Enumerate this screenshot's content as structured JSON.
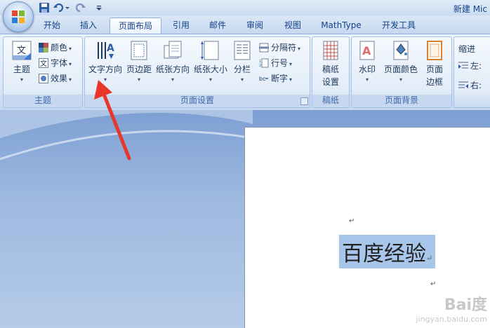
{
  "title_bar": {
    "title": "新建 Mic",
    "quick_access": [
      "save-icon",
      "undo-icon",
      "redo-icon",
      "customize-icon"
    ]
  },
  "tabs": [
    {
      "label": "开始",
      "active": false
    },
    {
      "label": "插入",
      "active": false
    },
    {
      "label": "页面布局",
      "active": true
    },
    {
      "label": "引用",
      "active": false
    },
    {
      "label": "邮件",
      "active": false
    },
    {
      "label": "审阅",
      "active": false
    },
    {
      "label": "视图",
      "active": false
    },
    {
      "label": "MathType",
      "active": false
    },
    {
      "label": "开发工具",
      "active": false
    }
  ],
  "ribbon": {
    "theme_group": {
      "label": "主题",
      "theme_button": "主题",
      "colors": "颜色",
      "fonts": "字体",
      "effects": "效果",
      "theme_icon_text": "文"
    },
    "page_setup_group": {
      "label": "页面设置",
      "text_direction": "文字方向",
      "margins": "页边距",
      "orientation": "纸张方向",
      "size": "纸张大小",
      "columns": "分栏",
      "breaks": "分隔符",
      "line_numbers": "行号",
      "hyphenation": "断字"
    },
    "manuscript_group": {
      "label": "稿纸",
      "button_line1": "稿纸",
      "button_line2": "设置"
    },
    "page_background_group": {
      "label": "页面背景",
      "watermark": "水印",
      "page_color": "页面颜色",
      "page_borders_line1": "页面",
      "page_borders_line2": "边框"
    },
    "paragraph_group": {
      "indent": "缩进",
      "left": "左:",
      "right": "右:"
    }
  },
  "document": {
    "selected_text": "百度经验",
    "para_mark": "↵"
  },
  "watermark": {
    "brand": "Bai度",
    "site": "jingyan.baidu.com"
  },
  "colors": {
    "arrow": "#e8362a",
    "selection": "#a8c6ea"
  }
}
